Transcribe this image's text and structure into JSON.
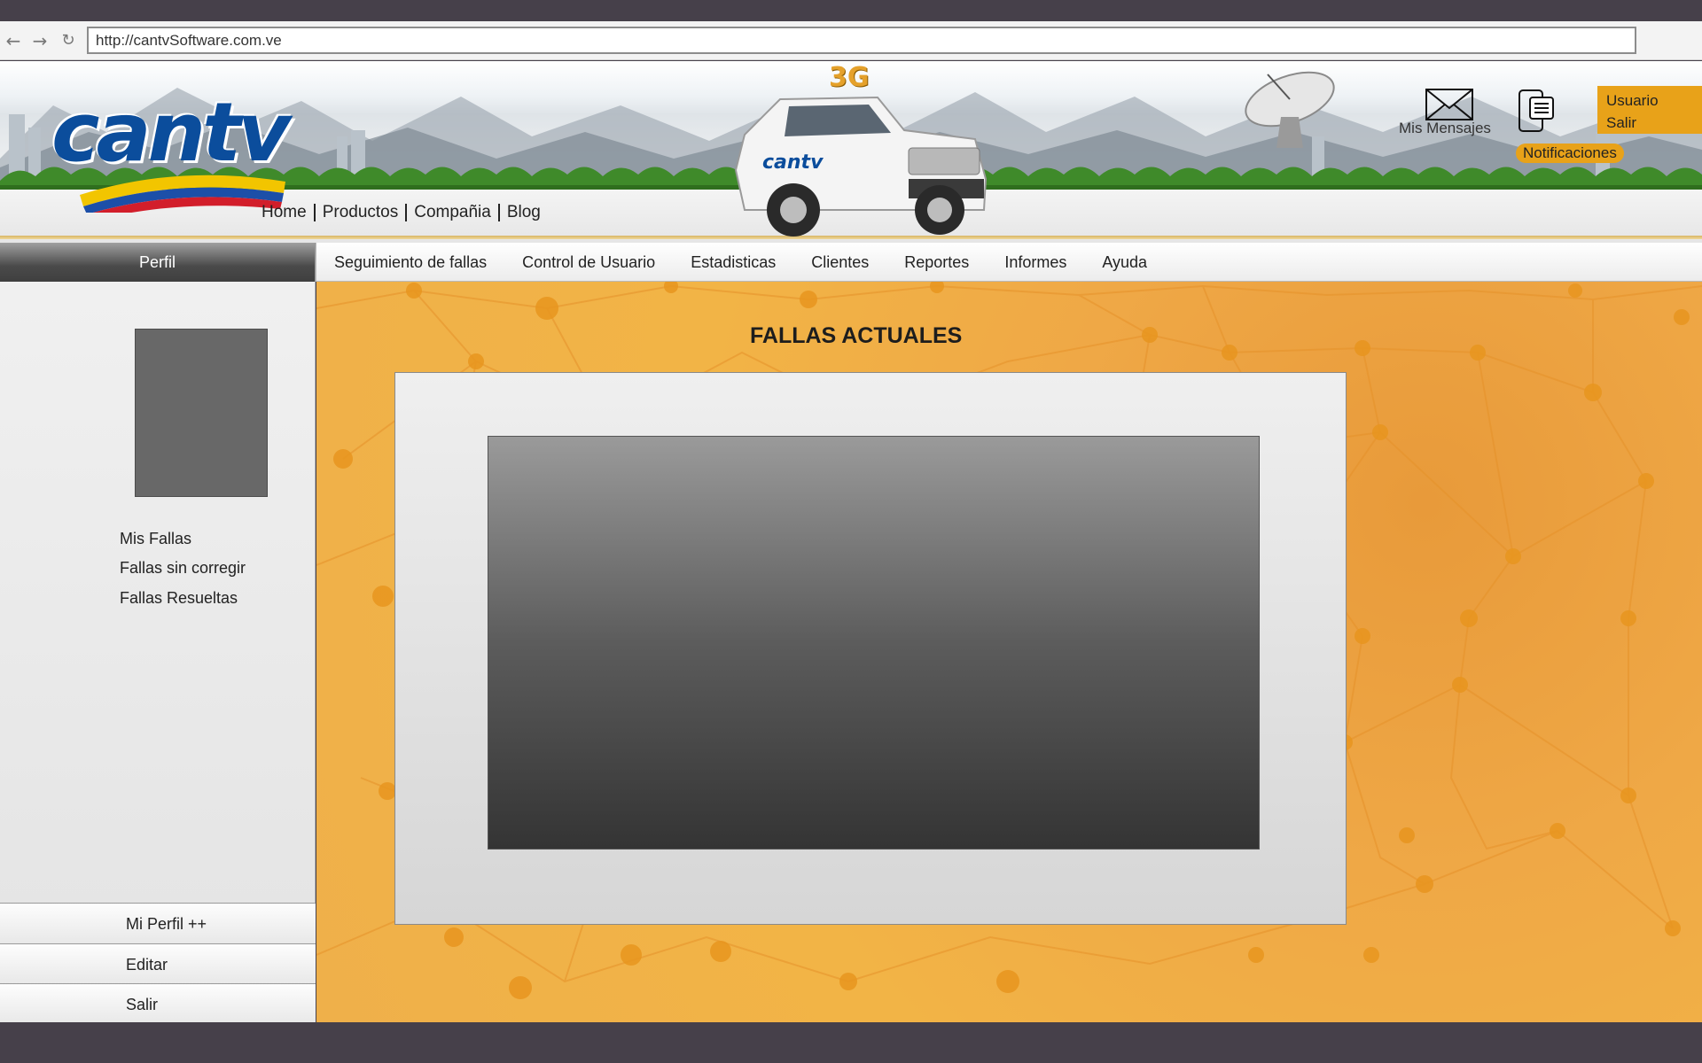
{
  "browser": {
    "url": "http://cantvSoftware.com.ve",
    "back_icon": "back-arrow-icon",
    "forward_icon": "forward-arrow-icon",
    "reload_icon": "reload-icon"
  },
  "header": {
    "logo_text": "cantv",
    "badge_3g": "3G",
    "top_nav": [
      "Home",
      "Productos",
      "Compañia",
      "Blog"
    ],
    "messages_label": "Mis Mensajes",
    "notifications_label": "Notificaciones",
    "user_menu": {
      "user": "Usuario",
      "logout": "Salir"
    }
  },
  "menu": {
    "profile_tab": "Perfil",
    "items": [
      "Seguimiento de fallas",
      "Control de Usuario",
      "Estadisticas",
      "Clientes",
      "Reportes",
      "Informes",
      "Ayuda"
    ]
  },
  "sidebar": {
    "links": [
      "Mis Fallas",
      "Fallas sin corregir",
      "Fallas Resueltas"
    ],
    "buttons": [
      "Mi Perfil ++",
      "Editar",
      "Salir"
    ]
  },
  "main": {
    "title": "FALLAS ACTUALES"
  },
  "colors": {
    "accent": "#e8a219",
    "logo_blue": "#0b4d9c",
    "chrome": "#46404a"
  }
}
